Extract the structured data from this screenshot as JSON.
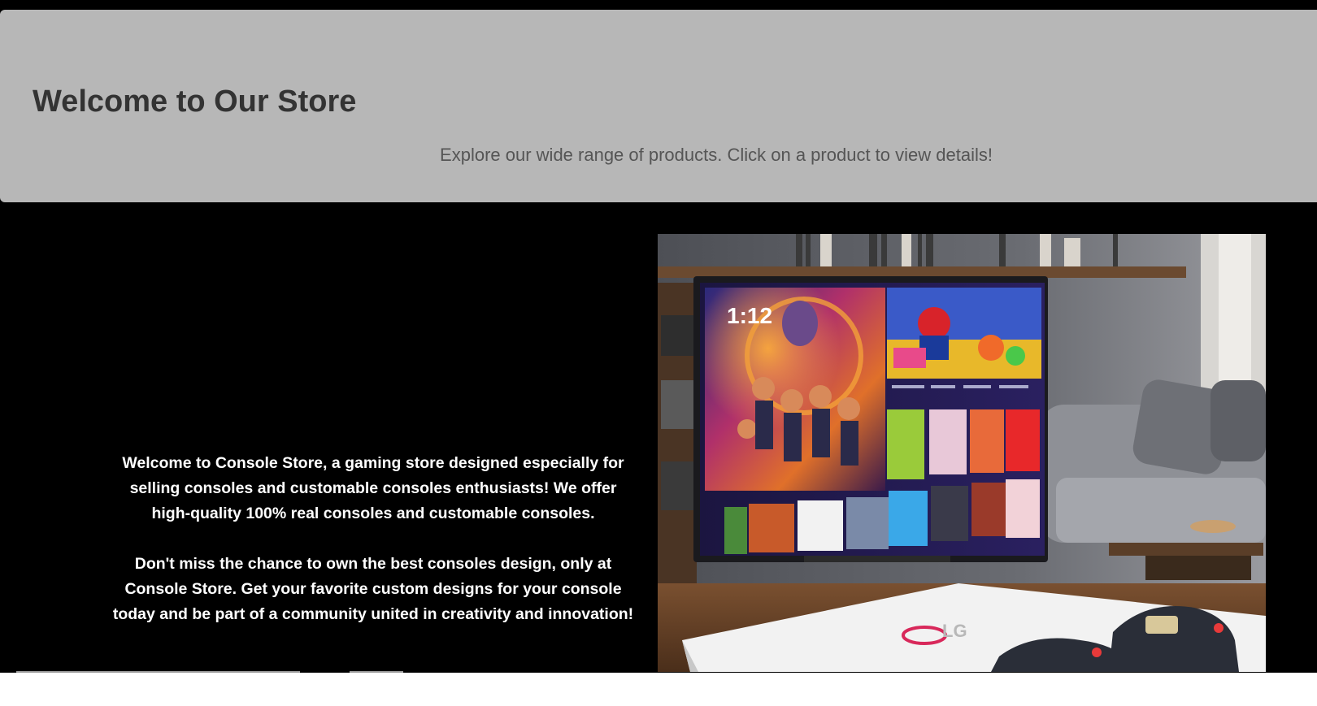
{
  "header": {
    "title": "Welcome to Our Store",
    "subtitle": "Explore our wide range of products. Click on a product to view details!"
  },
  "intro": {
    "paragraph1": "Welcome to Console Store, a gaming store designed especially for selling consoles and customable consoles enthusiasts! We offer high-quality 100% real consoles and customable consoles.",
    "paragraph2": "Don't miss the chance to own the best consoles design, only at Console Store. Get your favorite custom designs for your console today and be part of a community united in creativity and innovation!"
  },
  "hero_image": {
    "tv_clock": "1:12",
    "console_brand": "LG"
  }
}
